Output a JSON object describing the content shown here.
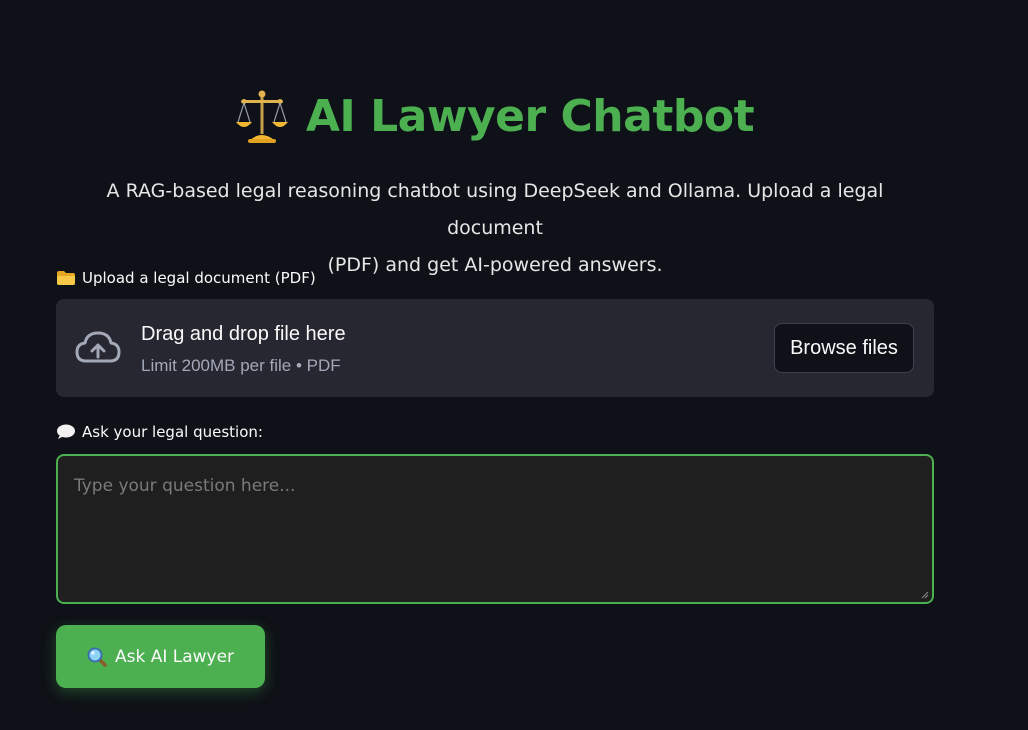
{
  "header": {
    "title": "AI Lawyer Chatbot",
    "title_icon": "scales-icon",
    "subtitle_line1": "A RAG-based legal reasoning chatbot using DeepSeek and Ollama. Upload a legal document",
    "subtitle_line2": "(PDF) and get AI-powered answers."
  },
  "upload": {
    "label": "Upload a legal document (PDF)",
    "label_icon": "folder-icon",
    "drop_text": "Drag and drop file here",
    "limit_text": "Limit 200MB per file • PDF",
    "browse_label": "Browse files",
    "icon": "cloud-upload-icon"
  },
  "question": {
    "label": "Ask your legal question:",
    "label_icon": "speech-bubble-icon",
    "placeholder": "Type your question here...",
    "value": ""
  },
  "ask_button": {
    "label": "Ask AI Lawyer",
    "icon": "magnifier-icon"
  },
  "colors": {
    "background": "#0e1117",
    "accent": "#4caf50",
    "panel": "#262730",
    "input_bg": "#1f1f1f"
  }
}
